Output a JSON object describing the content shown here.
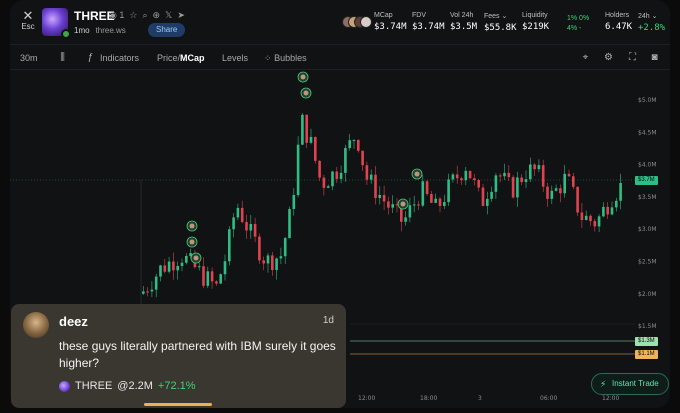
{
  "header": {
    "esc_icon": "close-icon",
    "esc_label": "Esc",
    "ticker": "THREE",
    "watchers": "1",
    "age": "1mo",
    "domain": "three.ws",
    "share_label": "Share",
    "stats": [
      {
        "key": "MCap",
        "value": "$3.74M"
      },
      {
        "key": "FDV",
        "value": "$3.74M"
      },
      {
        "key": "Vol 24h",
        "value": "$3.5M"
      },
      {
        "key": "Fees",
        "value": "$55.8K"
      },
      {
        "key": "Liquidity",
        "value": "$219K"
      },
      {
        "key": "Holders",
        "value": "6.47K"
      },
      {
        "key": "24h",
        "value": "+2.8%"
      }
    ],
    "changes_top": "1%  0%",
    "changes_bottom": "4%  -"
  },
  "toolbar": {
    "interval": "30m",
    "indicators": "Indicators",
    "price_label": "Price/",
    "mcap_label": "MCap",
    "levels": "Levels",
    "bubbles": "Bubbles"
  },
  "chart_data": {
    "type": "candlestick",
    "y_ticks": [
      "$5.0M",
      "$4.5M",
      "$4.0M",
      "$3.5M",
      "$3.0M",
      "$2.5M",
      "$2.0M",
      "$1.5M"
    ],
    "x_ticks": [
      "12:00",
      "18:00",
      "3",
      "06:00",
      "12:00"
    ],
    "current_price_label": "$3.7M",
    "level_labels": [
      "$1.3M",
      "$1.1M"
    ],
    "colors": {
      "up": "#2ebd85",
      "down": "#e0434f"
    }
  },
  "comment": {
    "user": "deez",
    "time": "1d",
    "text": "these guys literally partnered with IBM surely it goes higher?",
    "token": "THREE",
    "mcap": "@2.2M",
    "change": "+72.1%"
  },
  "instant_trade": "Instant Trade"
}
